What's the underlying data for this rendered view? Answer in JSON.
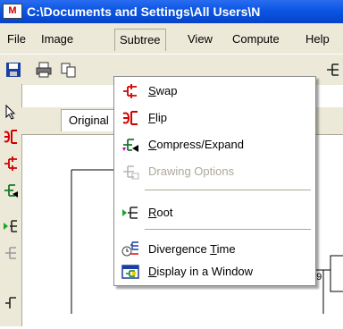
{
  "window": {
    "title": "C:\\Documents and Settings\\All Users\\N",
    "app_icon_text": "M"
  },
  "menubar": [
    {
      "label": "File"
    },
    {
      "label": "Image"
    },
    {
      "label": "Subtree"
    },
    {
      "label": "View"
    },
    {
      "label": "Compute"
    },
    {
      "label": "Help"
    }
  ],
  "tabs": {
    "active_label": "Original"
  },
  "canvas": {
    "node_value": "99"
  },
  "subtree_menu": {
    "items": [
      {
        "pre": "",
        "mnemonic": "S",
        "post": "wap",
        "icon": "swap-icon",
        "enabled": true
      },
      {
        "pre": "",
        "mnemonic": "F",
        "post": "lip",
        "icon": "flip-icon",
        "enabled": true
      },
      {
        "pre": "",
        "mnemonic": "C",
        "post": "ompress/Expand",
        "icon": "compress-expand-icon",
        "enabled": true
      },
      {
        "pre": "Drawing Options",
        "mnemonic": "",
        "post": "",
        "icon": "drawing-options-icon",
        "enabled": false
      },
      {
        "pre": "",
        "mnemonic": "R",
        "post": "oot",
        "icon": "root-icon",
        "enabled": true
      },
      {
        "pre": "Divergence ",
        "mnemonic": "T",
        "post": "ime",
        "icon": "divergence-time-icon",
        "enabled": true
      },
      {
        "pre": "",
        "mnemonic": "D",
        "post": "isplay in a Window",
        "icon": "display-window-icon",
        "enabled": true
      }
    ]
  },
  "colors": {
    "titlebar": "#0a56e2",
    "menu_bg": "#ece9d8",
    "tree_icon_red": "#d40000",
    "tree_icon_green": "#1a8f2a"
  }
}
